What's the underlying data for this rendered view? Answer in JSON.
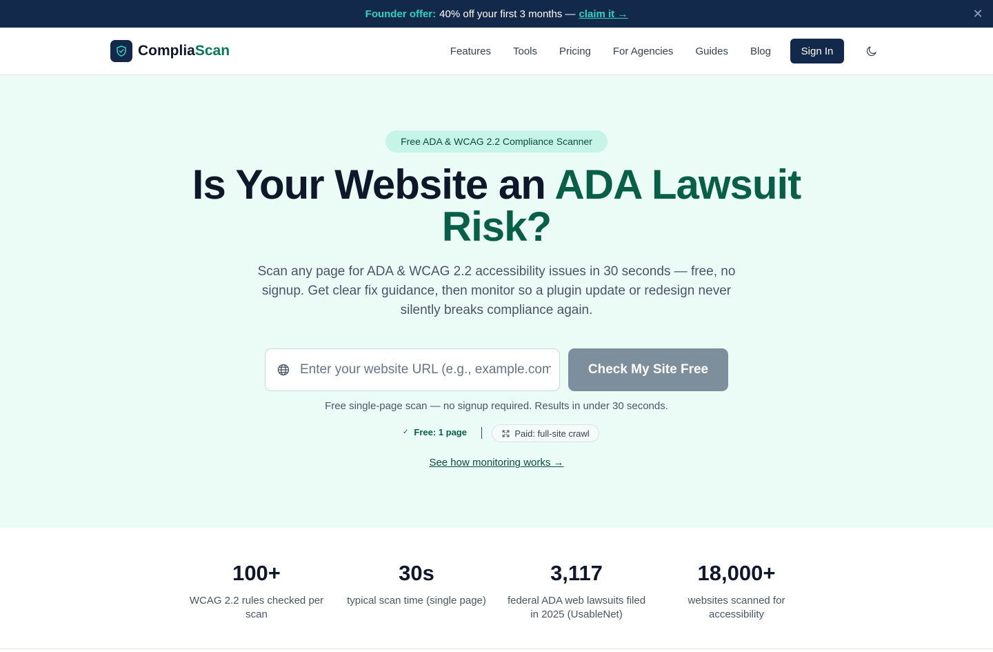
{
  "announcement": {
    "lead": "Founder offer:",
    "text": "40% off your first 3 months —",
    "link": "claim it →",
    "close_icon": "close-icon"
  },
  "nav": {
    "brand_main": "Complia",
    "brand_accent": "Scan",
    "brand_icon": "shield-check-icon",
    "links": [
      "Features",
      "Tools",
      "Pricing",
      "For Agencies",
      "Guides",
      "Blog"
    ],
    "signin": "Sign In",
    "theme_icon": "moon-icon"
  },
  "hero": {
    "badge": "Free ADA & WCAG 2.2 Compliance Scanner",
    "headline_plain": "Is Your Website an",
    "headline_accent": "ADA Lawsuit Risk?",
    "subhead": "Scan any page for ADA & WCAG 2.2 accessibility issues in 30 seconds — free, no signup. Get clear fix guidance, then monitor so a plugin update or redesign never silently breaks compliance again.",
    "url_placeholder": "Enter your website URL (e.g., example.com)",
    "url_value": "",
    "url_icon": "globe-icon",
    "cta": "Check My Site Free",
    "fine_print": "Free single-page scan — no signup required. Results in under 30 seconds.",
    "plan_free": "Free: 1 page",
    "plan_paid": "Paid: full-site crawl",
    "monitor_link": "See how monitoring works →"
  },
  "stats": [
    {
      "value": "100+",
      "label": "WCAG 2.2 rules checked per scan"
    },
    {
      "value": "30s",
      "label": "typical scan time (single page)"
    },
    {
      "value": "3,117",
      "label": "federal ADA web lawsuits filed in 2025 (UsableNet)"
    },
    {
      "value": "18,000+",
      "label": "websites scanned for accessibility"
    }
  ],
  "colors": {
    "navy": "#13294b",
    "accent_green": "#047857",
    "teal": "#2dd4bf",
    "hero_bg": "#ebfbf6",
    "cta_disabled": "#7d8f9c"
  }
}
